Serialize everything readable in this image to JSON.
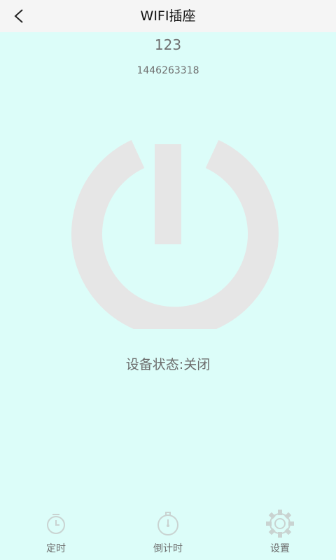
{
  "header": {
    "title": "WIFI插座",
    "back_icon": "back-arrow-icon"
  },
  "device": {
    "name": "123",
    "id": "1446263318",
    "status": "设备状态:关闭"
  },
  "power_icon": "power-icon",
  "tabs": [
    {
      "label": "定时",
      "icon": "timer-clock-icon"
    },
    {
      "label": "倒计时",
      "icon": "stopwatch-icon"
    },
    {
      "label": "设置",
      "icon": "gear-icon"
    }
  ],
  "colors": {
    "background": "#dcfdf9",
    "header_bg": "#f5f5f5",
    "power_icon": "#e6e6e6",
    "text_gray": "#6c6c6c",
    "tab_icon": "#c9d3d1"
  }
}
